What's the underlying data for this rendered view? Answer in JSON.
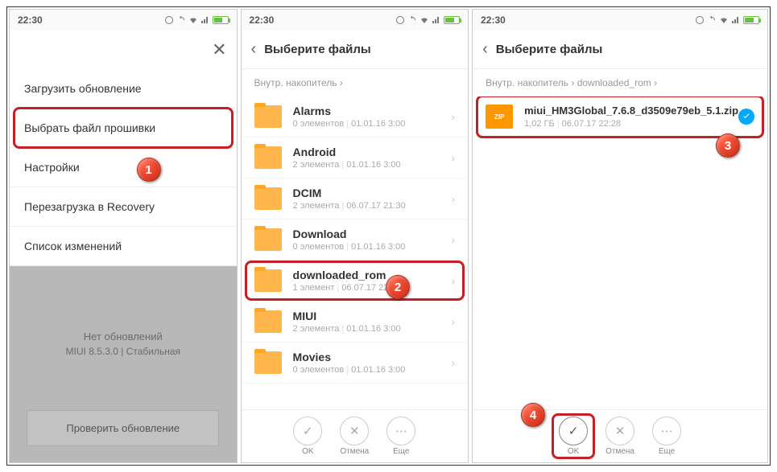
{
  "status": {
    "time": "22:30"
  },
  "phone1": {
    "menu": {
      "items": [
        {
          "label": "Загрузить обновление"
        },
        {
          "label": "Выбрать файл прошивки"
        },
        {
          "label": "Настройки"
        },
        {
          "label": "Перезагрузка в Recovery"
        },
        {
          "label": "Список изменений"
        }
      ]
    },
    "noupdate_title": "Нет обновлений",
    "noupdate_sub": "MIUI 8.5.3.0 | Стабильная",
    "check_btn": "Проверить обновление"
  },
  "phone2": {
    "title": "Выберите файлы",
    "breadcrumb_root": "Внутр. накопитель",
    "folders": [
      {
        "name": "Alarms",
        "meta_count": "0 элементов",
        "meta_date": "01.01.16 3:00"
      },
      {
        "name": "Android",
        "meta_count": "2 элемента",
        "meta_date": "01.01.16 3:00"
      },
      {
        "name": "DCIM",
        "meta_count": "2 элемента",
        "meta_date": "06.07.17 21:30"
      },
      {
        "name": "Download",
        "meta_count": "0 элементов",
        "meta_date": "01.01.16 3:00"
      },
      {
        "name": "downloaded_rom",
        "meta_count": "1 элемент",
        "meta_date": "06.07.17 22:27"
      },
      {
        "name": "MIUI",
        "meta_count": "2 элемента",
        "meta_date": "01.01.16 3:00"
      },
      {
        "name": "Movies",
        "meta_count": "0 элементов",
        "meta_date": "01.01.16 3:00"
      }
    ],
    "actions": {
      "ok": "OK",
      "cancel": "Отмена",
      "more": "Еще"
    }
  },
  "phone3": {
    "title": "Выберите файлы",
    "breadcrumb_root": "Внутр. накопитель",
    "breadcrumb_folder": "downloaded_rom",
    "file": {
      "icon_label": "ZIP",
      "name": "miui_HM3Global_7.6.8_d3509e79eb_5.1.zip",
      "size": "1,02 ГБ",
      "date": "06.07.17 22:28"
    },
    "actions": {
      "ok": "OK",
      "cancel": "Отмена",
      "more": "Еще"
    }
  },
  "badges": {
    "s1": "1",
    "s2": "2",
    "s3": "3",
    "s4": "4"
  }
}
